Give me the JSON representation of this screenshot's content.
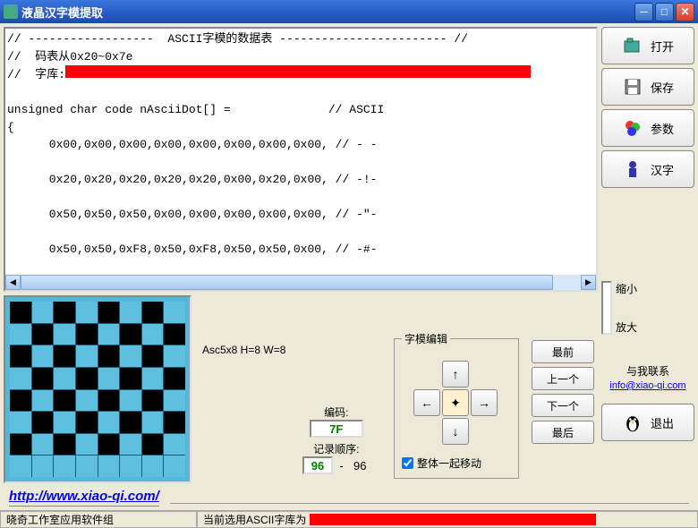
{
  "window": {
    "title": "液晶汉字模提取"
  },
  "code": {
    "line1": "// ------------------  ASCII字模的数据表 ------------------------ //",
    "line2": "//  码表从0x20~0x7e",
    "line3_prefix": "//  字库:",
    "line4": "unsigned char code nAsciiDot[] =              // ASCII",
    "line5": "{",
    "line6": "      0x00,0x00,0x00,0x00,0x00,0x00,0x00,0x00, // - -",
    "line7": "      0x20,0x20,0x20,0x20,0x20,0x00,0x20,0x00, // -!-",
    "line8": "      0x50,0x50,0x50,0x00,0x00,0x00,0x00,0x00, // -\"-",
    "line9": "      0x50,0x50,0xF8,0x50,0xF8,0x50,0x50,0x00, // -#-"
  },
  "font_info": "Asc5x8 H=8 W=8",
  "encode": {
    "label": "编码:",
    "value": "7F"
  },
  "seq": {
    "label": "记录顺序:",
    "val1": "96",
    "sep": "-",
    "val2": "96"
  },
  "editgroup": {
    "legend": "字模编辑"
  },
  "move_together": {
    "label": "整体一起移动",
    "checked": true
  },
  "nav": {
    "first": "最前",
    "prev": "上一个",
    "next": "下一个",
    "last": "最后"
  },
  "side": {
    "open": "打开",
    "save": "保存",
    "params": "参数",
    "hanzi": "汉字",
    "exit": "退出"
  },
  "zoom": {
    "shrink": "缩小",
    "enlarge": "放大"
  },
  "contact": {
    "label": "与我联系",
    "email": "info@xiao-qi.com"
  },
  "url": "http://www.xiao-qi.com/",
  "status": {
    "group": "晓奇工作室应用软件组",
    "lib_prefix": "当前选用ASCII字库为"
  },
  "grid_pattern": [
    [
      1,
      0,
      1,
      0,
      1,
      0,
      1,
      0
    ],
    [
      0,
      1,
      0,
      1,
      0,
      1,
      0,
      1
    ],
    [
      1,
      0,
      1,
      0,
      1,
      0,
      1,
      0
    ],
    [
      0,
      1,
      0,
      1,
      0,
      1,
      0,
      1
    ],
    [
      1,
      0,
      1,
      0,
      1,
      0,
      1,
      0
    ],
    [
      0,
      1,
      0,
      1,
      0,
      1,
      0,
      1
    ],
    [
      1,
      0,
      1,
      0,
      1,
      0,
      1,
      0
    ],
    [
      0,
      0,
      0,
      0,
      0,
      0,
      0,
      0
    ]
  ]
}
